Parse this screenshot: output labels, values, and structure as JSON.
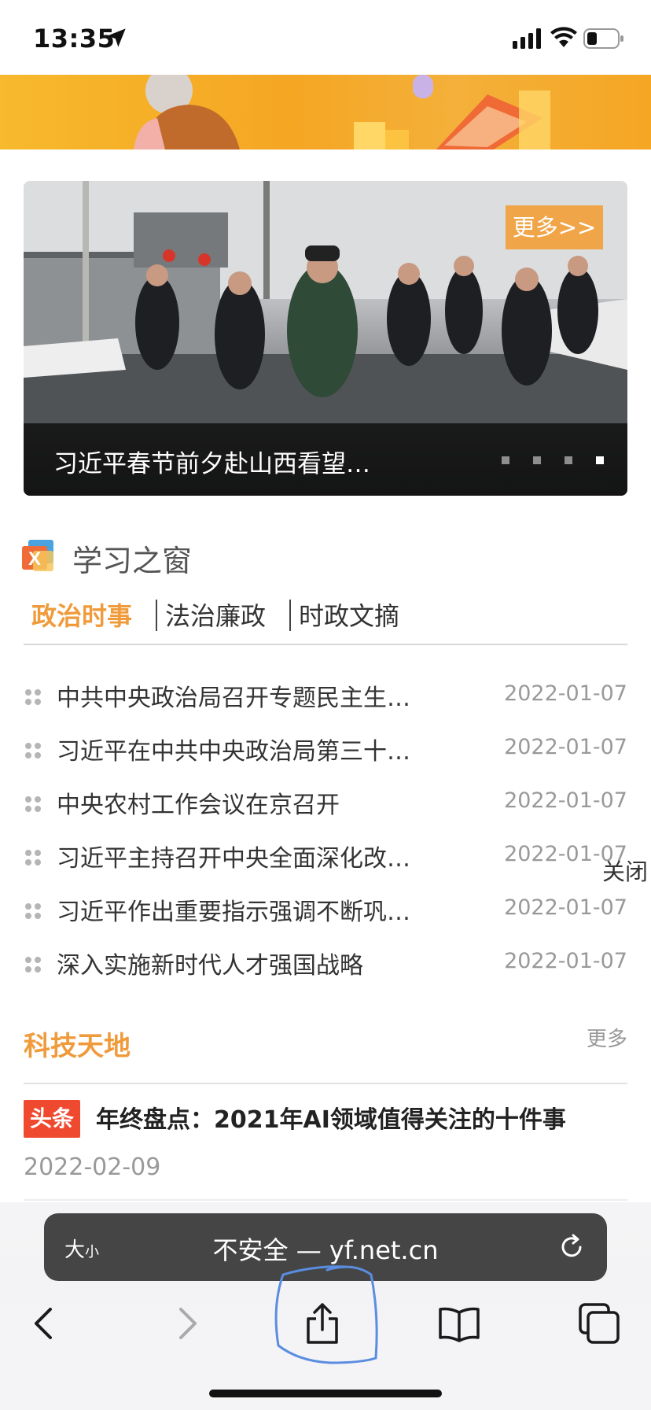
{
  "status_bar": {
    "time": "13:35",
    "icons": [
      "location-arrow-icon",
      "cellular-signal-icon",
      "wifi-icon",
      "battery-icon"
    ]
  },
  "carousel": {
    "more_label": "更多>>",
    "caption": "习近平春节前夕赴山西看望…",
    "slide_count": 4,
    "active_slide": 4
  },
  "study": {
    "logo_letter": "X",
    "title": "学习之窗",
    "tabs": [
      {
        "label": "政治时事",
        "active": true
      },
      {
        "label": "法治廉政",
        "active": false
      },
      {
        "label": "时政文摘",
        "active": false
      }
    ],
    "items": [
      {
        "title": "中共中央政治局召开专题民主生…",
        "date": "2022-01-07"
      },
      {
        "title": "习近平在中共中央政治局第三十…",
        "date": "2022-01-07"
      },
      {
        "title": "中央农村工作会议在京召开",
        "date": "2022-01-07"
      },
      {
        "title": "习近平主持召开中央全面深化改…",
        "date": "2022-01-07"
      },
      {
        "title": "习近平作出重要指示强调不断巩…",
        "date": "2022-01-07"
      },
      {
        "title": "深入实施新时代人才强国战略",
        "date": "2022-01-07"
      }
    ],
    "close_label": "关闭"
  },
  "tech": {
    "title": "科技天地",
    "more_label": "更多",
    "badge": "头条",
    "headline": "年终盘点：2021年AI领域值得关注的十件事",
    "date": "2022-02-09"
  },
  "browser": {
    "text_size_label": "大",
    "text_size_small": "小",
    "address": "不安全 — yf.net.cn",
    "toolbar": [
      "back-icon",
      "forward-icon",
      "share-icon",
      "bookmarks-icon",
      "tabs-icon"
    ]
  },
  "colors": {
    "accent": "#ef9b3c",
    "more_button": "#f0a548",
    "badge_red": "#ef4a30",
    "address_bar": "#454545",
    "annotation_circle": "#5a8de0"
  }
}
